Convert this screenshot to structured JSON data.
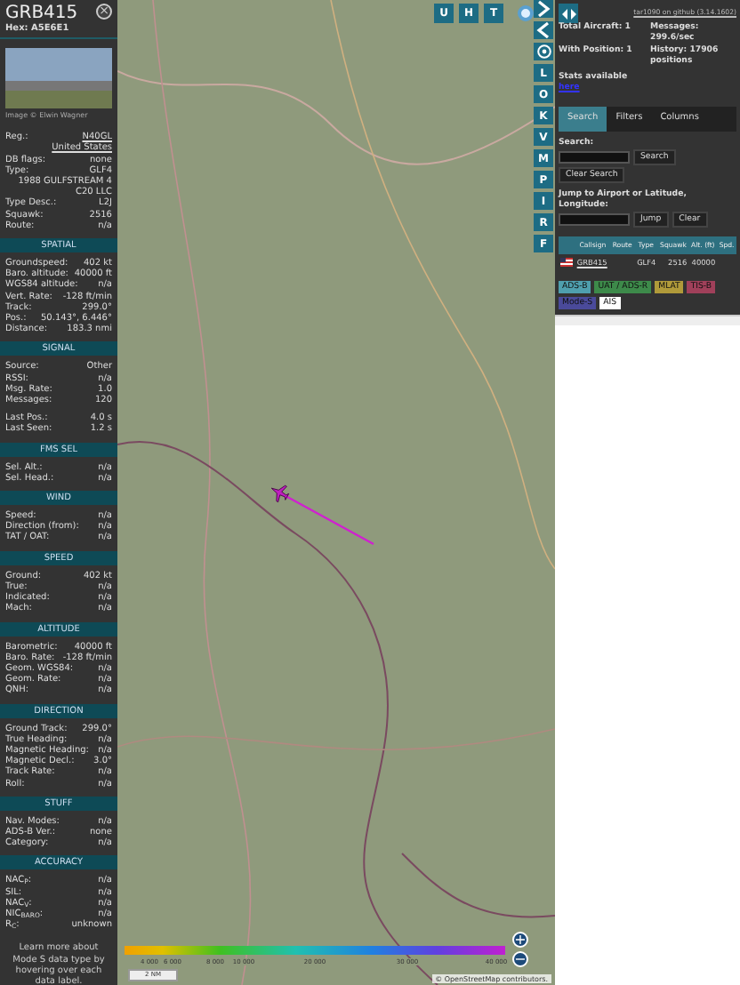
{
  "aircraft_panel": {
    "callsign": "GRB415",
    "hex": "Hex: A5E6E1",
    "close": "×",
    "photo_credit": "Image © Elwin Wagner",
    "info": [
      [
        {
          "label": "Reg.:",
          "value": "N40GL",
          "link": true
        },
        {
          "value": "United States",
          "link": true
        },
        {
          "label": "DB flags:",
          "value": "none"
        },
        {
          "label": "Type:",
          "value": "GLF4"
        },
        {
          "value": "1988 GULFSTREAM 4"
        },
        {
          "value": "C20 LLC"
        },
        {
          "label": "Type Desc.:",
          "value": "L2J"
        },
        {
          "label": "Squawk:",
          "value": "2516"
        },
        {
          "label": "Route:",
          "value": "n/a"
        }
      ]
    ],
    "sections": [
      {
        "title": "SPATIAL",
        "groups": [
          [
            {
              "label": "Groundspeed:",
              "value": "402 kt"
            },
            {
              "label": "Baro. altitude:",
              "value": "40000 ft"
            },
            {
              "label": "WGS84 altitude:",
              "value": "n/a"
            },
            {
              "label": "Vert. Rate:",
              "value": "-128 ft/min"
            },
            {
              "label": "Track:",
              "value": "299.0°"
            },
            {
              "label": "Pos.:",
              "value": "50.143°, 6.446°"
            },
            {
              "label": "Distance:",
              "value": "183.3 nmi"
            }
          ]
        ]
      },
      {
        "title": "SIGNAL",
        "groups": [
          [
            {
              "label": "Source:",
              "value": "Other"
            },
            {
              "label": "RSSI:",
              "value": "n/a"
            },
            {
              "label": "Msg. Rate:",
              "value": "1.0"
            },
            {
              "label": "Messages:",
              "value": "120"
            }
          ],
          [
            {
              "label": "Last Pos.:",
              "value": "4.0 s"
            },
            {
              "label": "Last Seen:",
              "value": "1.2 s"
            }
          ]
        ]
      },
      {
        "title": "FMS SEL",
        "groups": [
          [
            {
              "label": "Sel. Alt.:",
              "value": "n/a"
            },
            {
              "label": "Sel. Head.:",
              "value": "n/a"
            }
          ]
        ]
      },
      {
        "title": "WIND",
        "groups": [
          [
            {
              "label": "Speed:",
              "value": "n/a"
            },
            {
              "label": "Direction (from):",
              "value": "n/a"
            },
            {
              "label": "TAT / OAT:",
              "value": "n/a"
            }
          ]
        ]
      },
      {
        "title": "SPEED",
        "groups": [
          [
            {
              "label": "Ground:",
              "value": "402 kt"
            },
            {
              "label": "True:",
              "value": "n/a"
            },
            {
              "label": "Indicated:",
              "value": "n/a"
            },
            {
              "label": "Mach:",
              "value": "n/a"
            }
          ]
        ]
      },
      {
        "title": "ALTITUDE",
        "groups": [
          [
            {
              "label": "Barometric:",
              "value": "40000 ft"
            },
            {
              "label": "Baro. Rate:",
              "value": "-128 ft/min"
            },
            {
              "label": "Geom. WGS84:",
              "value": "n/a"
            },
            {
              "label": "Geom. Rate:",
              "value": "n/a"
            },
            {
              "label": "QNH:",
              "value": "n/a"
            }
          ]
        ]
      },
      {
        "title": "DIRECTION",
        "groups": [
          [
            {
              "label": "Ground Track:",
              "value": "299.0°"
            },
            {
              "label": "True Heading:",
              "value": "n/a"
            },
            {
              "label": "Magnetic Heading:",
              "value": "n/a"
            },
            {
              "label": "Magnetic Decl.:",
              "value": "3.0°"
            },
            {
              "label": "Track Rate:",
              "value": "n/a"
            },
            {
              "label": "Roll:",
              "value": "n/a"
            }
          ]
        ]
      },
      {
        "title": "STUFF",
        "groups": [
          [
            {
              "label": "Nav. Modes:",
              "value": "n/a"
            },
            {
              "label": "ADS-B Ver.:",
              "value": "none"
            },
            {
              "label": "Category:",
              "value": "n/a"
            }
          ]
        ]
      },
      {
        "title": "ACCURACY",
        "groups": [
          [
            {
              "label": "NAC$_{P}$:",
              "value": "n/a"
            },
            {
              "label": "SIL:",
              "value": "n/a"
            },
            {
              "label": "NAC$_{V}$:",
              "value": "n/a"
            },
            {
              "label": "NIC$_{BARO}$:",
              "value": "n/a"
            },
            {
              "label": "R$_{C}$:",
              "value": "unknown"
            }
          ]
        ]
      }
    ],
    "footer": "Learn more about Mode S data type by hovering over each data label."
  },
  "map": {
    "top_buttons": [
      "U",
      "H",
      "T"
    ],
    "side_buttons": [
      {
        "kind": "icon"
      },
      {
        "kind": "icon"
      },
      {
        "kind": "icon"
      },
      {
        "kind": "letter",
        "label": "L"
      },
      {
        "kind": "letter",
        "label": "O"
      },
      {
        "kind": "letter",
        "label": "K"
      },
      {
        "kind": "letter",
        "label": "V"
      },
      {
        "kind": "letter",
        "label": "M"
      },
      {
        "kind": "letter",
        "label": "P"
      },
      {
        "kind": "letter",
        "label": "I"
      },
      {
        "kind": "letter",
        "label": "R"
      },
      {
        "kind": "letter",
        "label": "F"
      }
    ],
    "altitude_labels": [
      "4 000",
      "6 000",
      "8 000",
      "10 000",
      "20 000",
      "30 000",
      "40 000"
    ],
    "scale": "2 NM",
    "zoom_in": "+",
    "zoom_out": "−",
    "attribution": "© OpenStreetMap contributors."
  },
  "side_panel": {
    "version": "tar1090 on github (3.14.1602)",
    "stats": [
      "Total Aircraft: 1",
      "Messages: 299.6/sec",
      "With Position: 1",
      "History: 17906 positions"
    ],
    "stats_note": "Stats available",
    "stats_link": "here",
    "tabs": [
      {
        "label": "Search",
        "selected": true
      },
      {
        "label": "Filters",
        "selected": false
      },
      {
        "label": "Columns",
        "selected": false
      }
    ],
    "search_label": "Search:",
    "search_button": "Search",
    "clear_search": "Clear Search",
    "jump_label": "Jump to Airport or Latitude, Longitude:",
    "jump_button": "Jump",
    "clear_button": "Clear",
    "table": {
      "columns": [
        "Callsign",
        "Route",
        "Type",
        "Squawk",
        "Alt. (ft)",
        "Spd."
      ],
      "rows": [
        {
          "callsign": "GRB415",
          "type": "GLF4",
          "squawk": "2516",
          "altitude": "40000"
        }
      ]
    },
    "legend": [
      {
        "label": "ADS-B",
        "color": "#4f9fae"
      },
      {
        "label": "UAT / ADS-R",
        "color": "#3d8a4a"
      },
      {
        "label": "MLAT",
        "color": "#b09a3a"
      },
      {
        "label": "TIS-B",
        "color": "#a0405a"
      },
      {
        "label": "Mode-S",
        "color": "#4a4a9a"
      },
      {
        "label": "AIS",
        "color": "#ffffff"
      }
    ]
  }
}
